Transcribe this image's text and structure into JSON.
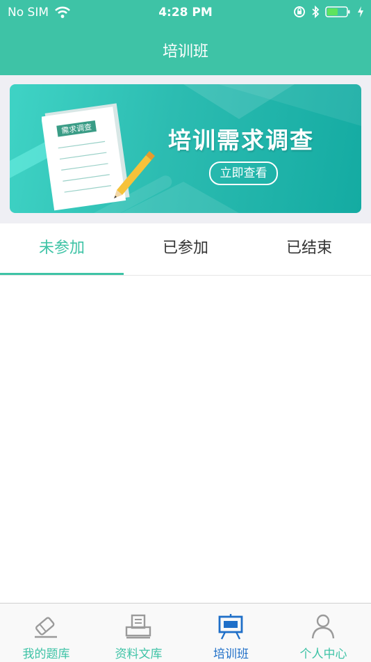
{
  "status_bar": {
    "carrier": "No SIM",
    "time": "4:28 PM"
  },
  "nav": {
    "title": "培训班"
  },
  "banner": {
    "doc_tag": "需求调查",
    "title": "培训需求调查",
    "button_label": "立即查看"
  },
  "tabs": [
    {
      "label": "未参加",
      "active": true
    },
    {
      "label": "已参加",
      "active": false
    },
    {
      "label": "已结束",
      "active": false
    }
  ],
  "tab_bar": [
    {
      "label": "我的题库",
      "icon": "pencil-eraser-icon",
      "active": false
    },
    {
      "label": "资料文库",
      "icon": "printer-icon",
      "active": false
    },
    {
      "label": "培训班",
      "icon": "easel-board-icon",
      "active": true
    },
    {
      "label": "个人中心",
      "icon": "person-icon",
      "active": false
    }
  ],
  "colors": {
    "accent": "#3ec3a6",
    "active_tab_bar": "#1f6fc8",
    "banner": "#2cbcb1"
  }
}
